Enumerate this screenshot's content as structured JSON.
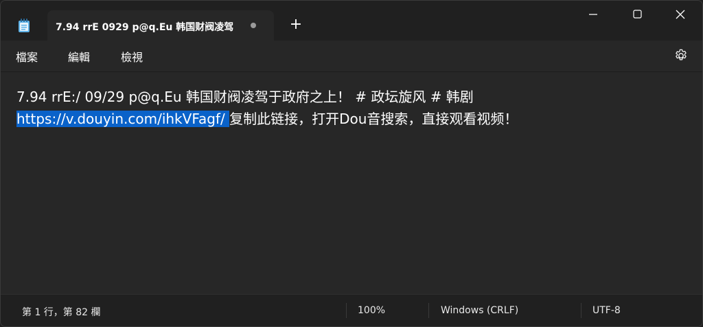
{
  "tab": {
    "title": "7.94 rrE 0929 p@q.Eu 韩国财阀凌驾",
    "new_tab_label": "+"
  },
  "menu": {
    "file": "檔案",
    "edit": "編輯",
    "view": "檢視"
  },
  "editor": {
    "line1": "7.94 rrE:/ 09/29 p@q.Eu 韩国财阀凌驾于政府之上！ # 政坛旋风 # 韩剧",
    "selected_link": "https://v.douyin.com/ihkVFagf/ ",
    "line2_rest": "复制此链接，打开Dou音搜索，直接观看视频！"
  },
  "status": {
    "position": "第 1 行，第 82 欄",
    "zoom": "100%",
    "line_ending": "Windows (CRLF)",
    "encoding": "UTF-8"
  },
  "colors": {
    "selection": "#0a62c9",
    "background": "#272727",
    "titlebar": "#202020"
  },
  "icons": {
    "app": "notepad-icon",
    "settings": "gear-icon",
    "minimize": "minimize-icon",
    "maximize": "maximize-icon",
    "close": "close-icon"
  }
}
